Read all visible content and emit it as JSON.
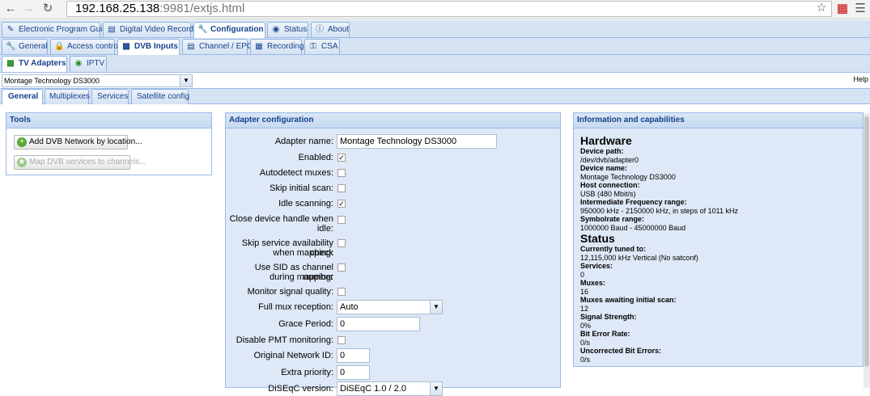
{
  "browser": {
    "url_host": "192.168.25.138",
    "url_path": ":9981/extjs.html"
  },
  "main_tabs": [
    {
      "label": "Electronic Program Guide",
      "icon": "epg-icon"
    },
    {
      "label": "Digital Video Recorder",
      "icon": "dvr-icon"
    },
    {
      "label": "Configuration",
      "icon": "wrench-icon",
      "active": true
    },
    {
      "label": "Status",
      "icon": "eye-icon"
    },
    {
      "label": "About",
      "icon": "info-icon"
    }
  ],
  "config_tabs": [
    {
      "label": "General",
      "icon": "wrench-icon"
    },
    {
      "label": "Access control",
      "icon": "lock-icon"
    },
    {
      "label": "DVB Inputs",
      "icon": "dvb-icon",
      "active": true
    },
    {
      "label": "Channel / EPG",
      "icon": "channel-icon"
    },
    {
      "label": "Recording",
      "icon": "recording-icon"
    },
    {
      "label": "CSA",
      "icon": "key-icon"
    }
  ],
  "dvb_tabs": [
    {
      "label": "TV Adapters",
      "icon": "tv-icon",
      "active": true
    },
    {
      "label": "IPTV",
      "icon": "iptv-icon"
    }
  ],
  "adapter_select": {
    "value": "Montage Technology DS3000"
  },
  "help": "Help",
  "adapter_tabs": [
    {
      "label": "General",
      "active": true
    },
    {
      "label": "Multiplexes"
    },
    {
      "label": "Services"
    },
    {
      "label": "Satellite config"
    }
  ],
  "tools": {
    "title": "Tools",
    "add_network": "Add DVB Network by location...",
    "map_services": "Map DVB services to channels..."
  },
  "adapter_config": {
    "title": "Adapter configuration",
    "adapter_name_label": "Adapter name:",
    "adapter_name_value": "Montage Technology DS3000",
    "enabled_label": "Enabled:",
    "enabled": true,
    "autodetect_label": "Autodetect muxes:",
    "autodetect": false,
    "skip_scan_label": "Skip initial scan:",
    "skip_scan": false,
    "idle_scan_label": "Idle scanning:",
    "idle_scan": true,
    "close_handle_label_1": "Close device handle when",
    "close_handle_label_2": "idle:",
    "close_handle": false,
    "skip_avail_label_1": "Skip service availability check",
    "skip_avail_label_2": "when mapping:",
    "skip_avail": false,
    "use_sid_label_1": "Use SID as channel number",
    "use_sid_label_2": "during mapping:",
    "use_sid": false,
    "monitor_label": "Monitor signal quality:",
    "monitor": false,
    "full_mux_label": "Full mux reception:",
    "full_mux_value": "Auto",
    "grace_label": "Grace Period:",
    "grace_value": "0",
    "disable_pmt_label": "Disable PMT monitoring:",
    "disable_pmt": false,
    "onid_label": "Original Network ID:",
    "onid_value": "0",
    "extra_prio_label": "Extra priority:",
    "extra_prio_value": "0",
    "diseqc_label": "DiSEqC version:",
    "diseqc_value": "DiSEqC 1.0 / 2.0"
  },
  "info": {
    "title": "Information and capabilities",
    "hardware_heading": "Hardware",
    "device_path_label": "Device path:",
    "device_path": "/dev/dvb/adapter0",
    "device_name_label": "Device name:",
    "device_name": "Montage Technology DS3000",
    "host_conn_label": "Host connection:",
    "host_conn": "USB (480 Mbit/s)",
    "if_range_label": "Intermediate Frequency range:",
    "if_range": "950000 kHz - 2150000 kHz, in steps of 1011 kHz",
    "sr_range_label": "Symbolrate range:",
    "sr_range": "1000000 Baud - 45000000 Baud",
    "status_heading": "Status",
    "tuned_label": "Currently tuned to:",
    "tuned": "12,115,000 kHz Vertical (No satconf)",
    "services_label": "Services:",
    "services": "0",
    "muxes_label": "Muxes:",
    "muxes": "16",
    "awaiting_label": "Muxes awaiting initial scan:",
    "awaiting": "12",
    "signal_label": "Signal Strength:",
    "signal": "0%",
    "ber_label": "Bit Error Rate:",
    "ber": "0/s",
    "unc_label": "Uncorrected Bit Errors:",
    "unc": "0/s"
  }
}
